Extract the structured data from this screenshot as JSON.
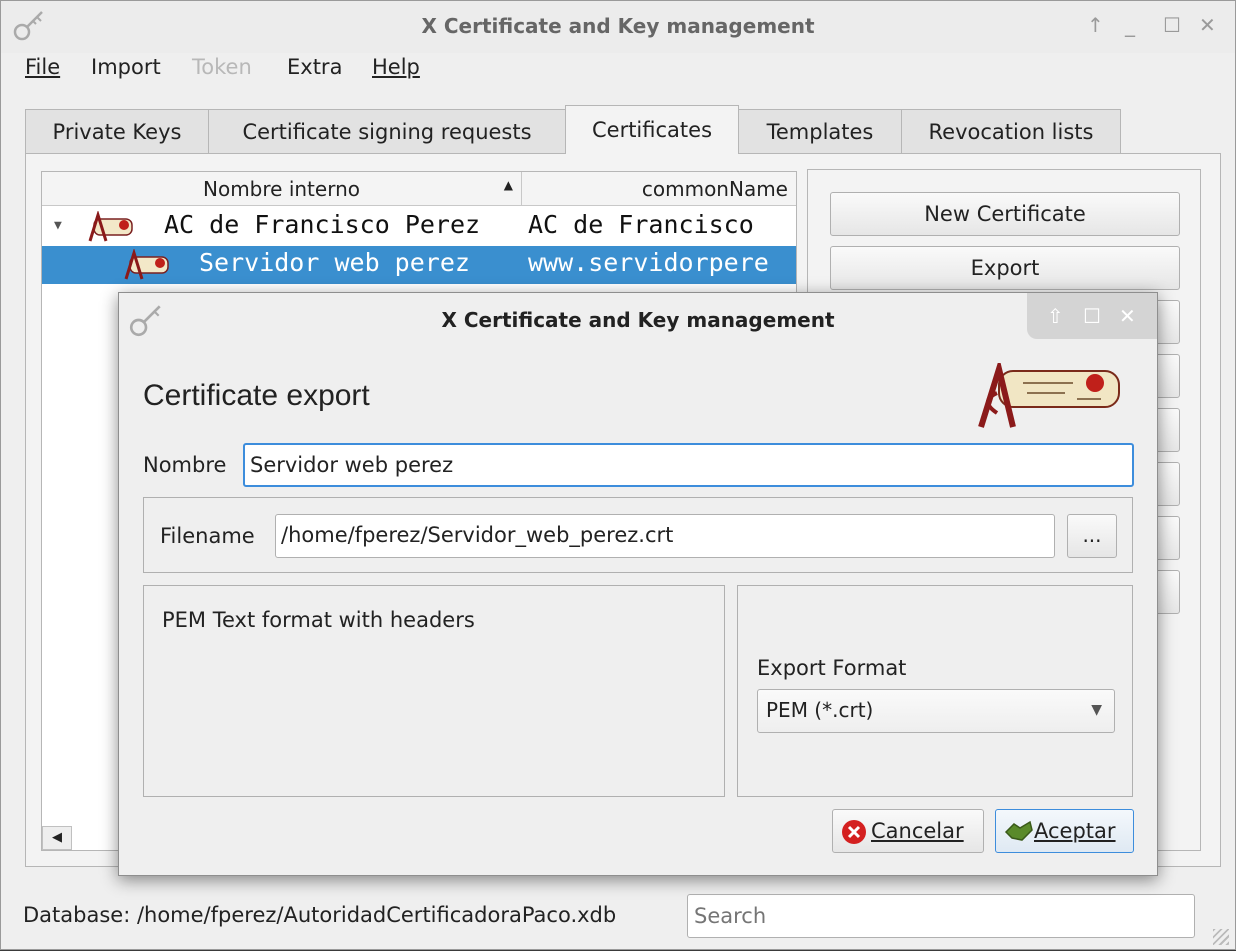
{
  "window": {
    "title": "X Certificate and Key management"
  },
  "menu": {
    "items": [
      {
        "label": "File"
      },
      {
        "label": "Import"
      },
      {
        "label": "Token"
      },
      {
        "label": "Extra"
      },
      {
        "label": "Help"
      }
    ]
  },
  "tabs": [
    {
      "label": "Private Keys"
    },
    {
      "label": "Certificate signing requests"
    },
    {
      "label": "Certificates"
    },
    {
      "label": "Templates"
    },
    {
      "label": "Revocation lists"
    }
  ],
  "active_tab": "Certificates",
  "tree": {
    "columns": [
      "Nombre interno",
      "commonName"
    ],
    "rows": [
      {
        "name": "AC de Francisco Perez",
        "common_name": "AC de Francisco",
        "expanded": true,
        "selected": false
      },
      {
        "name": "Servidor web perez",
        "common_name": "www.servidorpere",
        "selected": true
      }
    ]
  },
  "side_buttons": [
    "New Certificate",
    "Export"
  ],
  "status": {
    "database": "Database: /home/fperez/AutoridadCertificadoraPaco.xdb",
    "search_placeholder": "Search"
  },
  "dialog": {
    "title": "X Certificate and Key management",
    "heading": "Certificate export",
    "name_label": "Nombre",
    "name_value": "Servidor web perez",
    "filename_label": "Filename",
    "filename_value": "/home/fperez/Servidor_web_perez.crt",
    "browse_label": "...",
    "format_description": "PEM Text format with headers",
    "export_format_label": "Export Format",
    "export_format_value": "PEM (*.crt)",
    "cancel_label": "Cancelar",
    "accept_label": "Aceptar"
  },
  "colors": {
    "selection": "#3a8fcf",
    "focus": "#3d8ddc"
  }
}
